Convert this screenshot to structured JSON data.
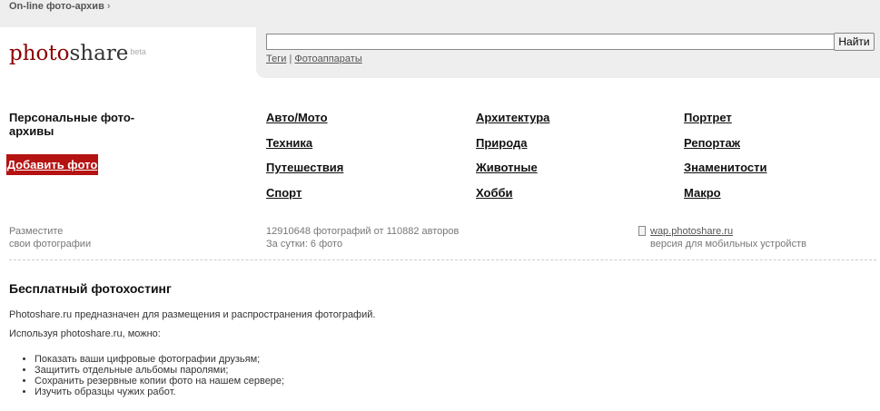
{
  "header": {
    "breadcrumb": "On-line фото-архив",
    "breadcrumb_arrow": "›",
    "logo_photo": "photo",
    "logo_share": "share",
    "logo_beta": "beta"
  },
  "search": {
    "value": "",
    "button_label": "Найти",
    "link_tags": "Теги",
    "separator": "|",
    "link_cameras": "Фотоаппараты"
  },
  "personal": {
    "title": "Персональные фото-архивы",
    "add_button": "Добавить фото",
    "hint_line1": "Разместите",
    "hint_line2": "свои фотографии"
  },
  "categories": {
    "col1": [
      "Авто/Мото",
      "Техника",
      "Путешествия",
      "Спорт"
    ],
    "col2": [
      "Архитектура",
      "Природа",
      "Животные",
      "Хобби"
    ],
    "col3": [
      "Портрет",
      "Репортаж",
      "Знаменитости",
      "Макро"
    ]
  },
  "stats": {
    "total": "12910648 фотографий от 110882 авторов",
    "daily": "За сутки: 6 фото"
  },
  "mobile": {
    "link": "wap.photoshare.ru",
    "caption": "версия для мобильных устройств"
  },
  "about": {
    "heading": "Бесплатный фотохостинг",
    "para1": "Photoshare.ru предназначен для размещения и распространения фотографий.",
    "para2": "Используя photoshare.ru, можно:",
    "features": [
      "Показать ваши цифровые фотографии друзьям;",
      "Защитить отдельные альбомы паролями;",
      "Сохранить резервные копии фото на нашем сервере;",
      "Изучить образцы чужих работ."
    ]
  }
}
